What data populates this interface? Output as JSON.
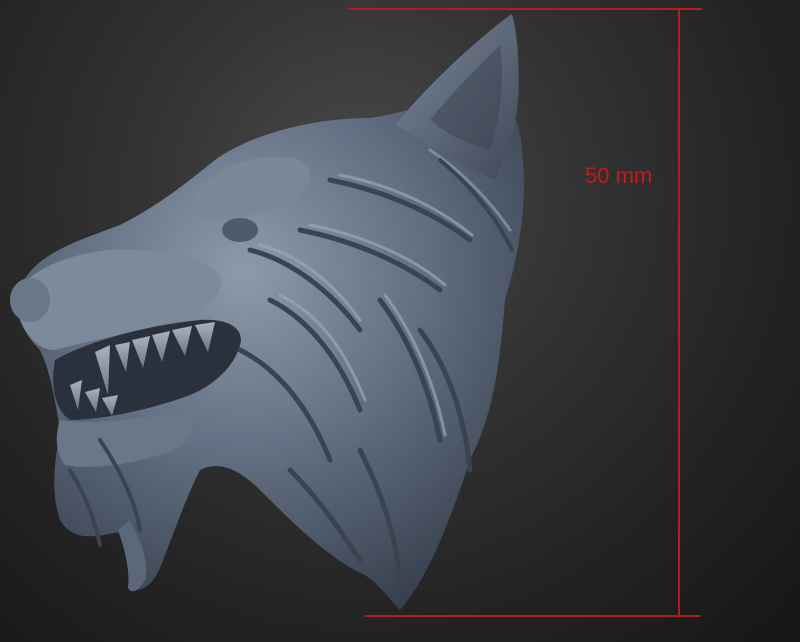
{
  "measurement": {
    "label": "50 mm",
    "color": "#b51c1c"
  },
  "model": {
    "icon": "wolf-head-sculpt",
    "base_color": "#5d6a7b",
    "shadow_color": "#2f3744",
    "highlight_color": "#8f9cac"
  }
}
